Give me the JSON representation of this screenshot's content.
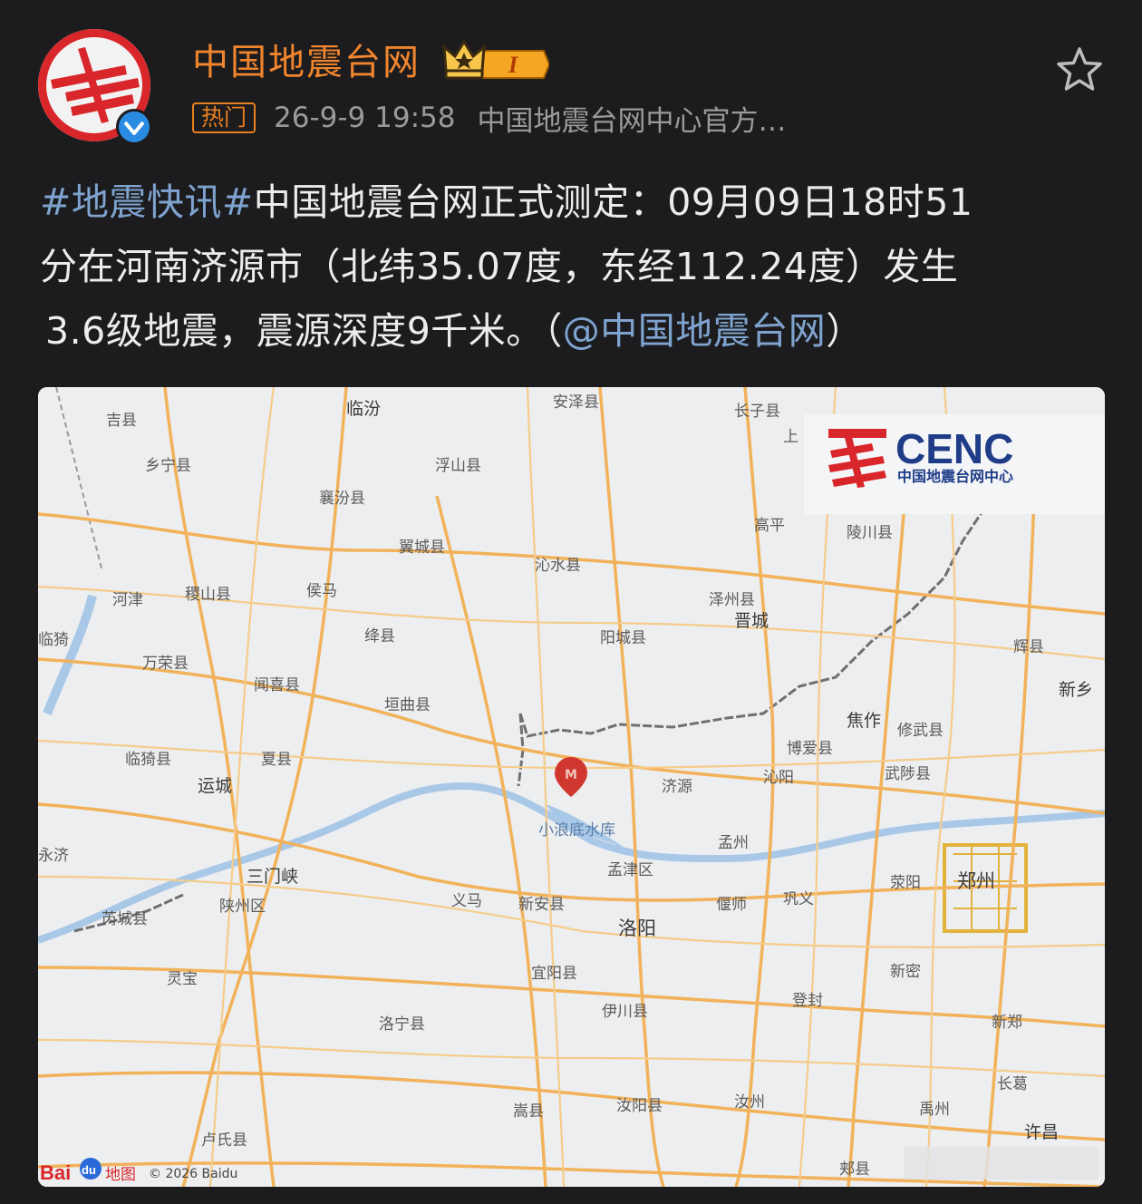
{
  "author": {
    "name": "中国地震台网",
    "level": "I"
  },
  "meta": {
    "hot_label": "热门",
    "timestamp": "26-9-9 19:58",
    "source": "中国地震台网中心官方…"
  },
  "post": {
    "hashtag": "#地震快讯#",
    "line1_rest": "中国地震台网正式测定：09月09日18时51",
    "line2": "分在河南济源市（北纬35.07度，东经112.24度）发生",
    "line3_prefix": "3.6级地震，震源深度9千米。（",
    "mention": "@中国地震台网",
    "line3_suffix": "）"
  },
  "map": {
    "logo_text": "CENC",
    "logo_sub": "中国地震台网中心",
    "baidu_label": "Bai",
    "baidu_du": "du",
    "baidu_map": "地图",
    "copyright": "© 2026 Baidu",
    "places": {
      "jixian": "吉县",
      "linfen": "临汾",
      "anze": "安泽县",
      "zhangzi": "长子县",
      "shang": "上",
      "xiangning": "乡宁县",
      "fushan": "浮山县",
      "xiangfen": "襄汾县",
      "gaoping": "高平",
      "lingchuan": "陵川县",
      "yicheng": "翼城县",
      "qinshui": "沁水县",
      "hejin": "河津",
      "jishan": "稷山县",
      "houma": "侯马",
      "zezhou": "泽州县",
      "jincheng": "晋城",
      "linyi": "临猗",
      "jiangxian": "绛县",
      "yangcheng": "阳城县",
      "huixian": "辉县",
      "wanrong": "万荣县",
      "wenxi": "闻喜县",
      "xinxiang": "新乡",
      "yuanqu": "垣曲县",
      "jiaozuo": "焦作",
      "xiuwu": "修武县",
      "linjin": "临猗县",
      "xiaxian": "夏县",
      "boai": "博爱县",
      "qinyang": "沁阳",
      "wuzhi": "武陟县",
      "yuncheng": "运城",
      "jiyuan": "济源",
      "xiaolangdi": "小浪底水库",
      "mengzhou": "孟州",
      "yongji": "永济",
      "sanmenxia": "三门峡",
      "mengjin": "孟津区",
      "xingyang": "荥阳",
      "zhengzhou": "郑州",
      "ruicheng": "芮城县",
      "shanzhou": "陕州区",
      "yima": "义马",
      "xinan": "新安县",
      "yanshi": "偃师",
      "gongyi": "巩义",
      "luoyang": "洛阳",
      "lingbao": "灵宝",
      "yiyang": "宜阳县",
      "xinmi": "新密",
      "dengfeng": "登封",
      "luoning": "洛宁县",
      "yichuan": "伊川县",
      "xinzheng": "新郑",
      "changge": "长葛",
      "songxian": "嵩县",
      "ruyang": "汝阳县",
      "ruzhou": "汝州",
      "yuzhou": "禹州",
      "lushi": "卢氏县",
      "xuchang": "许昌",
      "jiaxian": "郏县"
    }
  }
}
